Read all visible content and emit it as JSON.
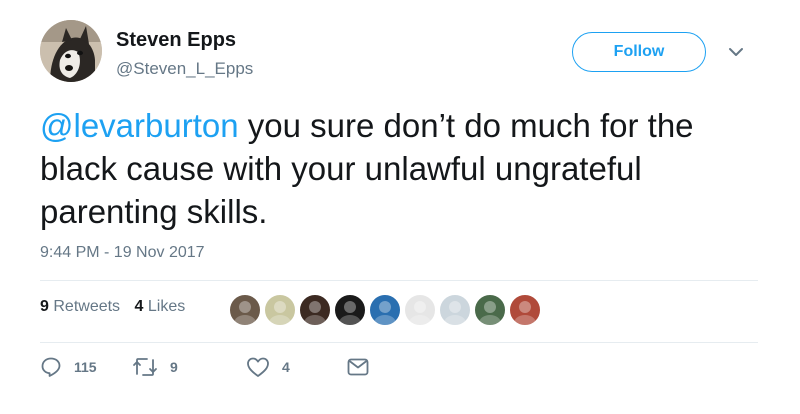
{
  "author": {
    "display_name": "Steven Epps",
    "username": "@Steven_L_Epps",
    "avatar_icon": "husky-dog-avatar"
  },
  "follow_label": "Follow",
  "tweet": {
    "mention": "@levarburton",
    "text_line1": " you sure don’t do much for the",
    "text_line2": "black cause with your unlawful ungrateful",
    "text_line3": "parenting skills."
  },
  "timestamp": "9:44 PM - 19 Nov 2017",
  "stats": {
    "retweets_count": "9",
    "retweets_label": "Retweets",
    "likes_count": "4",
    "likes_label": "Likes"
  },
  "liker_avatars": [
    {
      "name": "avatar-1",
      "color": "#6b5a4a"
    },
    {
      "name": "avatar-2",
      "color": "#c9c7a0"
    },
    {
      "name": "avatar-3",
      "color": "#3c2a22"
    },
    {
      "name": "avatar-4",
      "color": "#1a1a1a"
    },
    {
      "name": "avatar-5",
      "color": "#2a6fb0"
    },
    {
      "name": "avatar-6",
      "color": "#e6e6e6"
    },
    {
      "name": "avatar-7",
      "color": "#ccd6dd"
    },
    {
      "name": "avatar-8",
      "color": "#4a6a4a"
    },
    {
      "name": "avatar-9",
      "color": "#b04a3a"
    }
  ],
  "actions": {
    "replies": "115",
    "retweets": "9",
    "likes": "4"
  },
  "colors": {
    "accent": "#1da1f2",
    "secondary_text": "#657786",
    "primary_text": "#14171a"
  }
}
